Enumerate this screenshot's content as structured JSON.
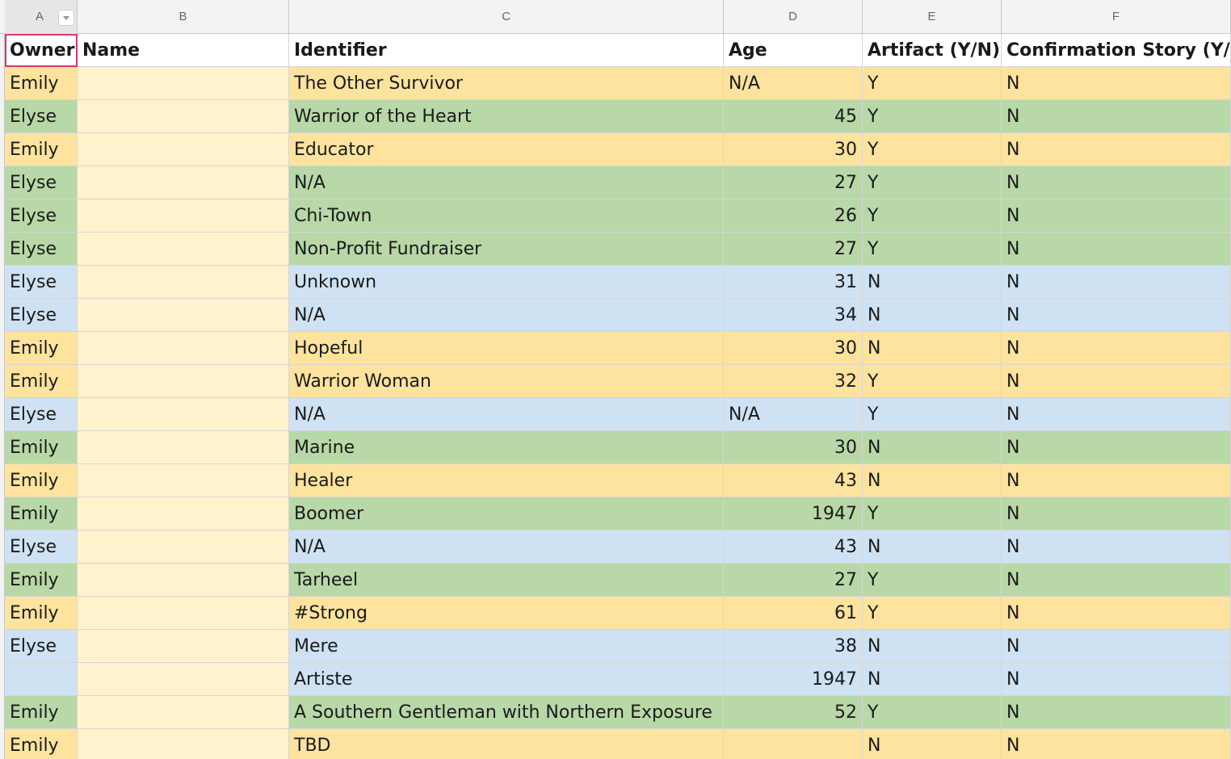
{
  "columns": [
    "A",
    "B",
    "C",
    "D",
    "E",
    "F"
  ],
  "headers": {
    "owner": "Owner",
    "name": "Name",
    "identifier": "Identifier",
    "age": "Age",
    "artifact": "Artifact (Y/N)",
    "confirmation": "Confirmation Story (Y/N)"
  },
  "colors": {
    "yellow": "#fde39e",
    "green": "#b8d8a7",
    "blue": "#cfe2f3",
    "name_column": "#fff2cc",
    "selected_border": "#d63a6b"
  },
  "rows": [
    {
      "owner": "Emily",
      "identifier": "The Other Survivor",
      "age": "N/A",
      "artifact": "Y",
      "confirmation": "N",
      "color": "yellow"
    },
    {
      "owner": "Elyse",
      "identifier": "Warrior of the Heart",
      "age": "45",
      "artifact": "Y",
      "confirmation": "N",
      "color": "green"
    },
    {
      "owner": "Emily",
      "identifier": "Educator",
      "age": "30",
      "artifact": "Y",
      "confirmation": "N",
      "color": "yellow"
    },
    {
      "owner": "Elyse",
      "identifier": "N/A",
      "age": "27",
      "artifact": "Y",
      "confirmation": "N",
      "color": "green"
    },
    {
      "owner": "Elyse",
      "identifier": "Chi-Town",
      "age": "26",
      "artifact": "Y",
      "confirmation": "N",
      "color": "green"
    },
    {
      "owner": "Elyse",
      "identifier": "Non-Profit Fundraiser",
      "age": "27",
      "artifact": "Y",
      "confirmation": "N",
      "color": "green"
    },
    {
      "owner": "Elyse",
      "identifier": "Unknown",
      "age": "31",
      "artifact": "N",
      "confirmation": "N",
      "color": "blue"
    },
    {
      "owner": "Elyse",
      "identifier": "N/A",
      "age": "34",
      "artifact": "N",
      "confirmation": "N",
      "color": "blue"
    },
    {
      "owner": "Emily",
      "identifier": "Hopeful",
      "age": "30",
      "artifact": "N",
      "confirmation": "N",
      "color": "yellow"
    },
    {
      "owner": "Emily",
      "identifier": "Warrior Woman",
      "age": "32",
      "artifact": "Y",
      "confirmation": "N",
      "color": "yellow"
    },
    {
      "owner": "Elyse",
      "identifier": "N/A",
      "age": "N/A",
      "artifact": "Y",
      "confirmation": "N",
      "color": "blue"
    },
    {
      "owner": "Emily",
      "identifier": "Marine",
      "age": "30",
      "artifact": "N",
      "confirmation": "N",
      "color": "green"
    },
    {
      "owner": "Emily",
      "identifier": "Healer",
      "age": "43",
      "artifact": "N",
      "confirmation": "N",
      "color": "yellow"
    },
    {
      "owner": "Emily",
      "identifier": "Boomer",
      "age": "1947",
      "artifact": "Y",
      "confirmation": "N",
      "color": "green"
    },
    {
      "owner": "Elyse",
      "identifier": "N/A",
      "age": "43",
      "artifact": "N",
      "confirmation": "N",
      "color": "blue"
    },
    {
      "owner": "Emily",
      "identifier": "Tarheel",
      "age": "27",
      "artifact": "Y",
      "confirmation": "N",
      "color": "green"
    },
    {
      "owner": "Emily",
      "identifier": "#Strong",
      "age": "61",
      "artifact": "Y",
      "confirmation": "N",
      "color": "yellow"
    },
    {
      "owner": "Elyse",
      "identifier": "Mere",
      "age": "38",
      "artifact": "N",
      "confirmation": "N",
      "color": "blue"
    },
    {
      "owner": "",
      "identifier": "Artiste",
      "age": "1947",
      "artifact": "N",
      "confirmation": "N",
      "color": "blue"
    },
    {
      "owner": "Emily",
      "identifier": "A Southern Gentleman with Northern Exposure",
      "age": "52",
      "artifact": "Y",
      "confirmation": "N",
      "color": "green"
    },
    {
      "owner": "Emily",
      "identifier": "TBD",
      "age": "",
      "artifact": "N",
      "confirmation": "N",
      "color": "yellow"
    }
  ]
}
